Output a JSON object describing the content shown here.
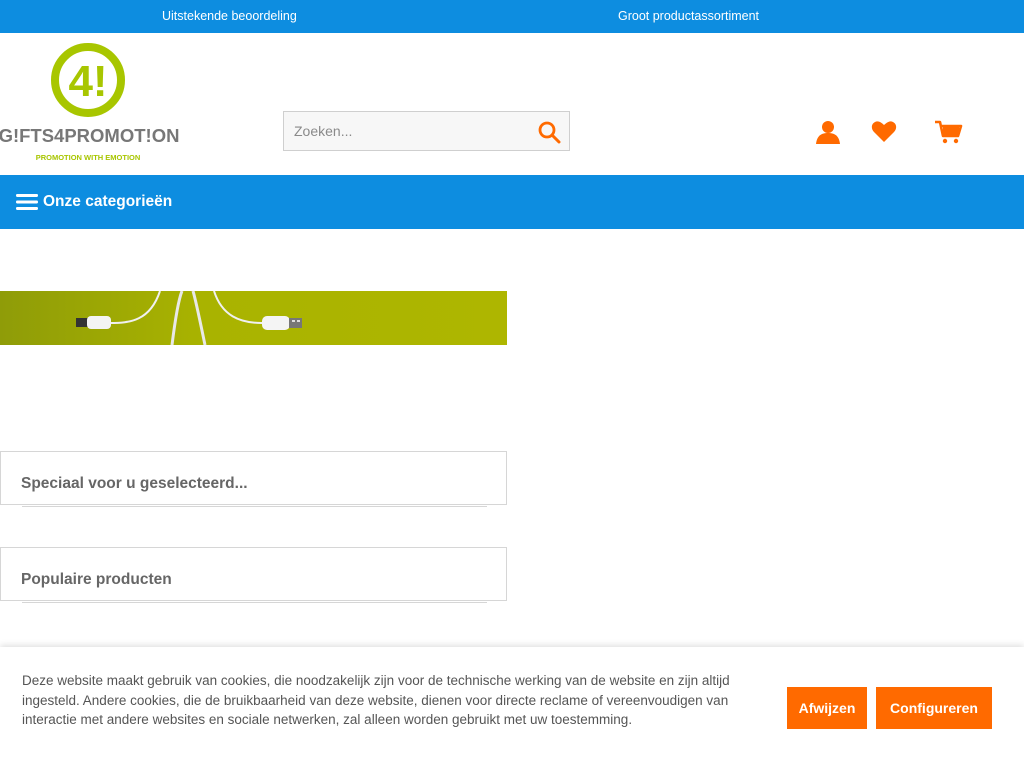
{
  "topbar": {
    "usp_rating": "Uitstekende beoordeling",
    "usp_assortment": "Groot productassortiment"
  },
  "header": {
    "logo_text": "G!FTS4PROMOT!ON",
    "logo_tagline": "PROMOTION WITH EMOTION",
    "logo_mark": "4!",
    "search_placeholder": "Zoeken..."
  },
  "nav": {
    "categories_label": "Onze categorieën"
  },
  "sections": {
    "selected_title": "Speciaal voor u geselecteerd...",
    "popular_title": "Populaire producten"
  },
  "cookie": {
    "text": "Deze website maakt gebruik van cookies, die noodzakelijk zijn voor de technische werking van de website en zijn altijd ingesteld. Andere cookies, die de bruikbaarheid van deze website, dienen voor directe reclame of vereenvoudigen van interactie met andere websites en sociale netwerken, zal alleen worden gebruikt met uw toestemming.",
    "reject_label": "Afwijzen",
    "configure_label": "Configureren"
  },
  "colors": {
    "brand_blue": "#0d8de0",
    "accent_orange": "#ff6a00",
    "logo_green": "#a8c600"
  }
}
